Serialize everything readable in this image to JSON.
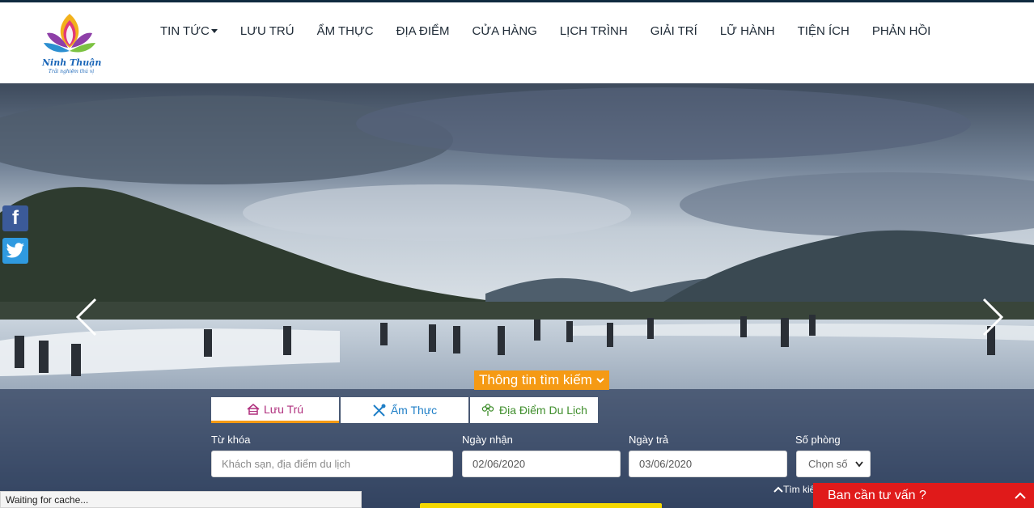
{
  "header": {
    "logo": {
      "name": "Ninh Thuận",
      "tagline": "Trải nghiệm thú vị"
    },
    "nav": [
      {
        "label": "TIN TỨC",
        "has_dropdown": true
      },
      {
        "label": "LƯU TRÚ"
      },
      {
        "label": "ẨM THỰC"
      },
      {
        "label": "ĐỊA ĐIỂM"
      },
      {
        "label": "CỬA HÀNG"
      },
      {
        "label": "LỊCH TRÌNH"
      },
      {
        "label": "GIẢI TRÍ"
      },
      {
        "label": "LỮ HÀNH"
      },
      {
        "label": "TIỆN ÍCH"
      },
      {
        "label": "PHẢN HỒI"
      }
    ]
  },
  "social": {
    "facebook_icon": "facebook-icon",
    "twitter_icon": "twitter-icon"
  },
  "search": {
    "toggle_label": "Thông tin tìm kiếm",
    "tabs": [
      {
        "label": "Lưu Trú",
        "icon": "house-icon",
        "color": "#b0307e"
      },
      {
        "label": "Ẩm Thực",
        "icon": "utensils-icon",
        "color": "#1f7fc7"
      },
      {
        "label": "Địa Điểm Du Lịch",
        "icon": "flower-icon",
        "color": "#3f8e2c"
      }
    ],
    "fields": {
      "keyword": {
        "label": "Từ khóa",
        "placeholder": "Khách sạn, địa điểm du lịch"
      },
      "checkin": {
        "label": "Ngày nhận",
        "value": "02/06/2020"
      },
      "checkout": {
        "label": "Ngày trả",
        "value": "03/06/2020"
      },
      "rooms": {
        "label": "Số phòng",
        "selected": "Chọn số"
      }
    },
    "collapse_label": "Tìm kiế"
  },
  "status_bar": {
    "text": "Waiting for cache..."
  },
  "chat": {
    "label": "Ban cần tư vấn ?"
  },
  "colors": {
    "accent": "#f59a14",
    "chat": "#e01a1a",
    "submit": "#f5d800",
    "header_line": "#0f2a3f"
  }
}
